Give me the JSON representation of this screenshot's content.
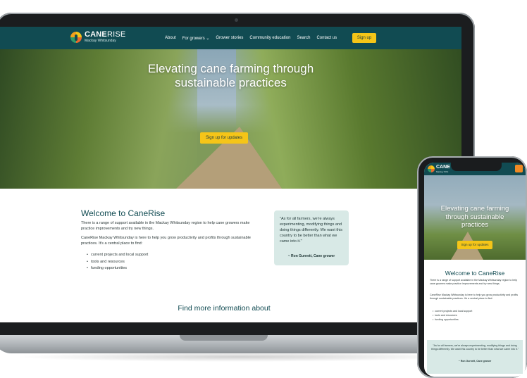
{
  "site": {
    "brand_bold": "CANE",
    "brand_light": "RISE",
    "brand_sub": "Mackay Whitsunday"
  },
  "nav": {
    "items": [
      {
        "label": "About"
      },
      {
        "label": "For growers ⌄"
      },
      {
        "label": "Grower stories"
      },
      {
        "label": "Community education"
      },
      {
        "label": "Search"
      },
      {
        "label": "Contact us"
      }
    ],
    "cta": "Sign up"
  },
  "hero": {
    "title_line1": "Elevating cane farming through",
    "title_line2": "sustainable practices",
    "cta": "Sign up for updates"
  },
  "welcome": {
    "title": "Welcome to CaneRise",
    "para1": "There is a range of support available in the Mackay Whitsunday region to help cane growers make practice improvements and try new things.",
    "para2": "CaneRise Mackay Whitsunday is here to help you grow productivity and profits through sustainable practices. It's a central place to find:",
    "bullets": [
      "current projects and local support",
      "tools and resources",
      "funding opportunities"
    ]
  },
  "quote": {
    "text": "\"As for all farmers, we're always experimenting, modifying things and doing things differently. We want this country to be better than what we came into it.\"",
    "author": "~ Ron Gurnett, Cane grower"
  },
  "find_more": "Find more information about",
  "mobile": {
    "brand": "CANE",
    "brand_sub": "Mackay Whit",
    "hero_title_line1": "Elevating cane farming",
    "hero_title_line2": "through sustainable",
    "hero_title_line3": "practices",
    "hero_cta": "Sign up for updates",
    "title": "Welcome to CaneRise",
    "para1": "There is a range of support available in the Mackay Whitsunday region to help cane growers make practice improvements and try new things.",
    "para2": "CaneRise Mackay Whitsunday is here to help you grow productivity and profits through sustainable practices. It's a central place to find:",
    "bullets": [
      "current projects and local support",
      "tools and resources",
      "funding opportunities"
    ],
    "quote": "\"As for all farmers, we're always experimenting, modifying things and doing things differently. We want this country to be better than what we came into it.\"",
    "quote_author": "~ Ron Gurnett, Cane grower"
  },
  "colors": {
    "primary": "#114b52",
    "accent": "#f5c518",
    "quote_bg": "#d8e9e6"
  }
}
